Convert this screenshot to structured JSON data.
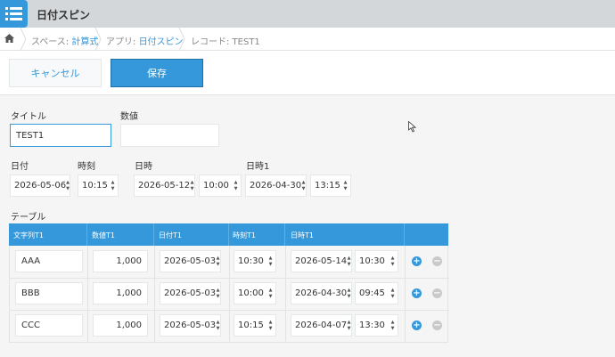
{
  "app": {
    "title": "日付スピン"
  },
  "breadcrumb": {
    "space_prefix": "スペース: ",
    "space_name": "計算式",
    "app_prefix": "アプリ: ",
    "app_name": "日付スピン",
    "record": "レコード: TEST1"
  },
  "toolbar": {
    "cancel_label": "キャンセル",
    "save_label": "保存"
  },
  "fields": {
    "title_label": "タイトル",
    "title_value": "TEST1",
    "number_label": "数値",
    "number_value": "",
    "date_label": "日付",
    "date_value": "2026-05-06",
    "time_label": "時刻",
    "time_value": "10:15",
    "datetime_label": "日時",
    "datetime_date": "2026-05-12",
    "datetime_time": "10:00",
    "datetime1_label": "日時1",
    "datetime1_date": "2026-04-30",
    "datetime1_time": "13:15"
  },
  "table": {
    "label": "テーブル",
    "headers": [
      "文字列T1",
      "数値T1",
      "日付T1",
      "時刻T1",
      "日時T1"
    ],
    "rows": [
      {
        "text": "AAA",
        "number": "1,000",
        "date": "2026-05-03",
        "time": "10:30",
        "dt_date": "2026-05-14",
        "dt_time": "10:30"
      },
      {
        "text": "BBB",
        "number": "1,000",
        "date": "2026-05-03",
        "time": "10:00",
        "dt_date": "2026-04-30",
        "dt_time": "09:45"
      },
      {
        "text": "CCC",
        "number": "1,000",
        "date": "2026-05-03",
        "time": "10:15",
        "dt_date": "2026-04-07",
        "dt_time": "13:30"
      }
    ],
    "add_symbol": "+",
    "remove_symbol": "−"
  },
  "spin_up": "▲",
  "spin_down": "▼"
}
